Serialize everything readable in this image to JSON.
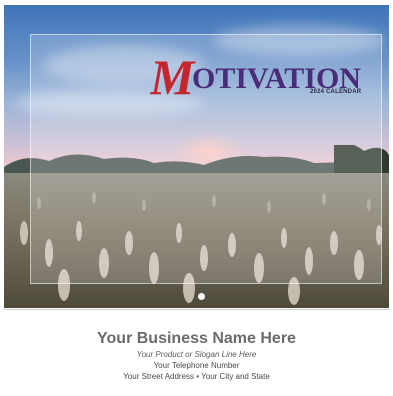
{
  "calendar": {
    "title": "MOTIVATION",
    "subtitle": "2024 CALENDAR"
  },
  "pager": {
    "current": 1,
    "total": 1
  },
  "imprint": {
    "business_name": "Your  Business Name Here",
    "slogan": "Your Product or Slogan Line Here",
    "phone": "Your Telephone Number",
    "address": "Your Street Address • Your City and State"
  },
  "colors": {
    "title_m": "#c4262e",
    "title_rest": "#4a2d78",
    "business_name": "#6b6b6b"
  }
}
